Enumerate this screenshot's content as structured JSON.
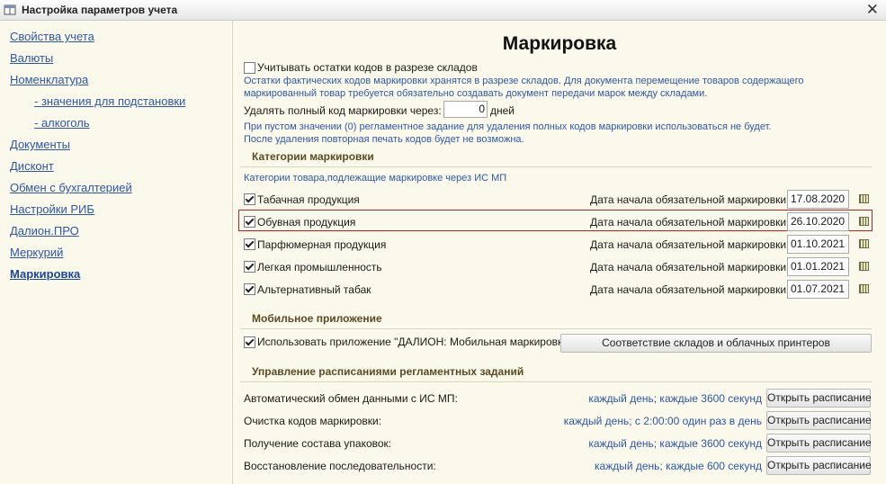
{
  "window": {
    "title": "Настройка параметров учета",
    "close_label": "✕"
  },
  "sidebar": {
    "items": [
      {
        "label": "Свойства учета"
      },
      {
        "label": "Валюты"
      },
      {
        "label": "Номенклатура"
      },
      {
        "label": "- значения для подстановки"
      },
      {
        "label": "- алкоголь"
      },
      {
        "label": "Документы"
      },
      {
        "label": "Дисконт"
      },
      {
        "label": "Обмен с бухгалтерией"
      },
      {
        "label": "Настройки РИБ"
      },
      {
        "label": "Далион.ПРО"
      },
      {
        "label": "Меркурий"
      },
      {
        "label": "Маркировка"
      }
    ]
  },
  "main": {
    "title": "Маркировка",
    "warehouse": {
      "checkbox_label": "Учитывать остатки кодов в разрезе складов",
      "checked": false,
      "hint1": "Остатки фактических кодов маркировки хранятся в разрезе складов. Для документа перемещение товаров содержащего",
      "hint2": "маркированный товар требуется обязательно создавать документ передачи марок между складами."
    },
    "delete_codes": {
      "label": "Удалять полный код маркировки через:",
      "value": "0",
      "unit": "дней",
      "hint1": "При пустом значении (0) регламентное задание для удаления полных кодов маркировки использоваться не будет.",
      "hint2": "После удаления повторная печать кодов будет не возможна."
    },
    "categories": {
      "section_title": "Категории маркировки",
      "hint": "Категории товара,подлежащие маркировке через ИС МП",
      "date_label": "Дата начала обязательной маркировки:",
      "items": [
        {
          "label": "Табачная продукция",
          "date": "17.08.2020"
        },
        {
          "label": "Обувная продукция",
          "date": "26.10.2020"
        },
        {
          "label": "Парфюмерная продукция",
          "date": "01.10.2021"
        },
        {
          "label": "Легкая промышленность",
          "date": "01.01.2021"
        },
        {
          "label": "Альтернативный табак",
          "date": "01.07.2021"
        }
      ]
    },
    "mobile": {
      "section_title": "Мобильное приложение",
      "checkbox_label": "Использовать приложение \"ДАЛИОН: Мобильная маркировка\"",
      "button_label": "Соответствие складов и облачных принтеров"
    },
    "schedules": {
      "section_title": "Управление расписаниями регламентных заданий",
      "button_label": "Открыть расписание",
      "items": [
        {
          "label": "Автоматический обмен данными с ИС МП:",
          "schedule": "каждый день; каждые 3600 секунд"
        },
        {
          "label": "Очистка кодов маркировки:",
          "schedule": "каждый день; с 2:00:00 один раз в день"
        },
        {
          "label": "Получение состава упаковок:",
          "schedule": "каждый день; каждые 3600 секунд"
        },
        {
          "label": "Восстановление последовательности:",
          "schedule": "каждый день; каждые 600 секунд"
        }
      ]
    }
  },
  "colors": {
    "background": "#fbf9ec",
    "link": "#2d56a8",
    "hint": "#2f58a6",
    "section": "#5c4a20",
    "highlight_border": "#bb2222"
  },
  "icons": {
    "app": "settings-window-icon",
    "calendar": "calendar-icon",
    "close": "close-icon"
  }
}
